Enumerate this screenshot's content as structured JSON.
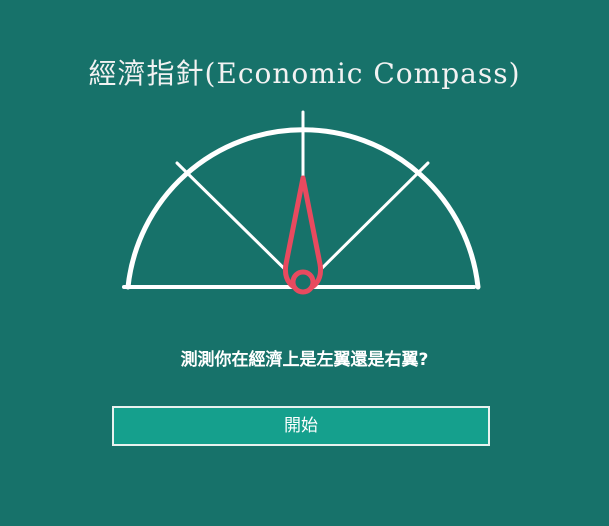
{
  "app": {
    "title": "經濟指針(Economic Compass)"
  },
  "main": {
    "question": "測測你在經濟上是左翼還是右翼?",
    "start_label": "開始"
  },
  "colors": {
    "background": "#17726a",
    "button_fill": "#15a08d",
    "needle": "#e84a5f",
    "chalk": "#ffffff"
  }
}
